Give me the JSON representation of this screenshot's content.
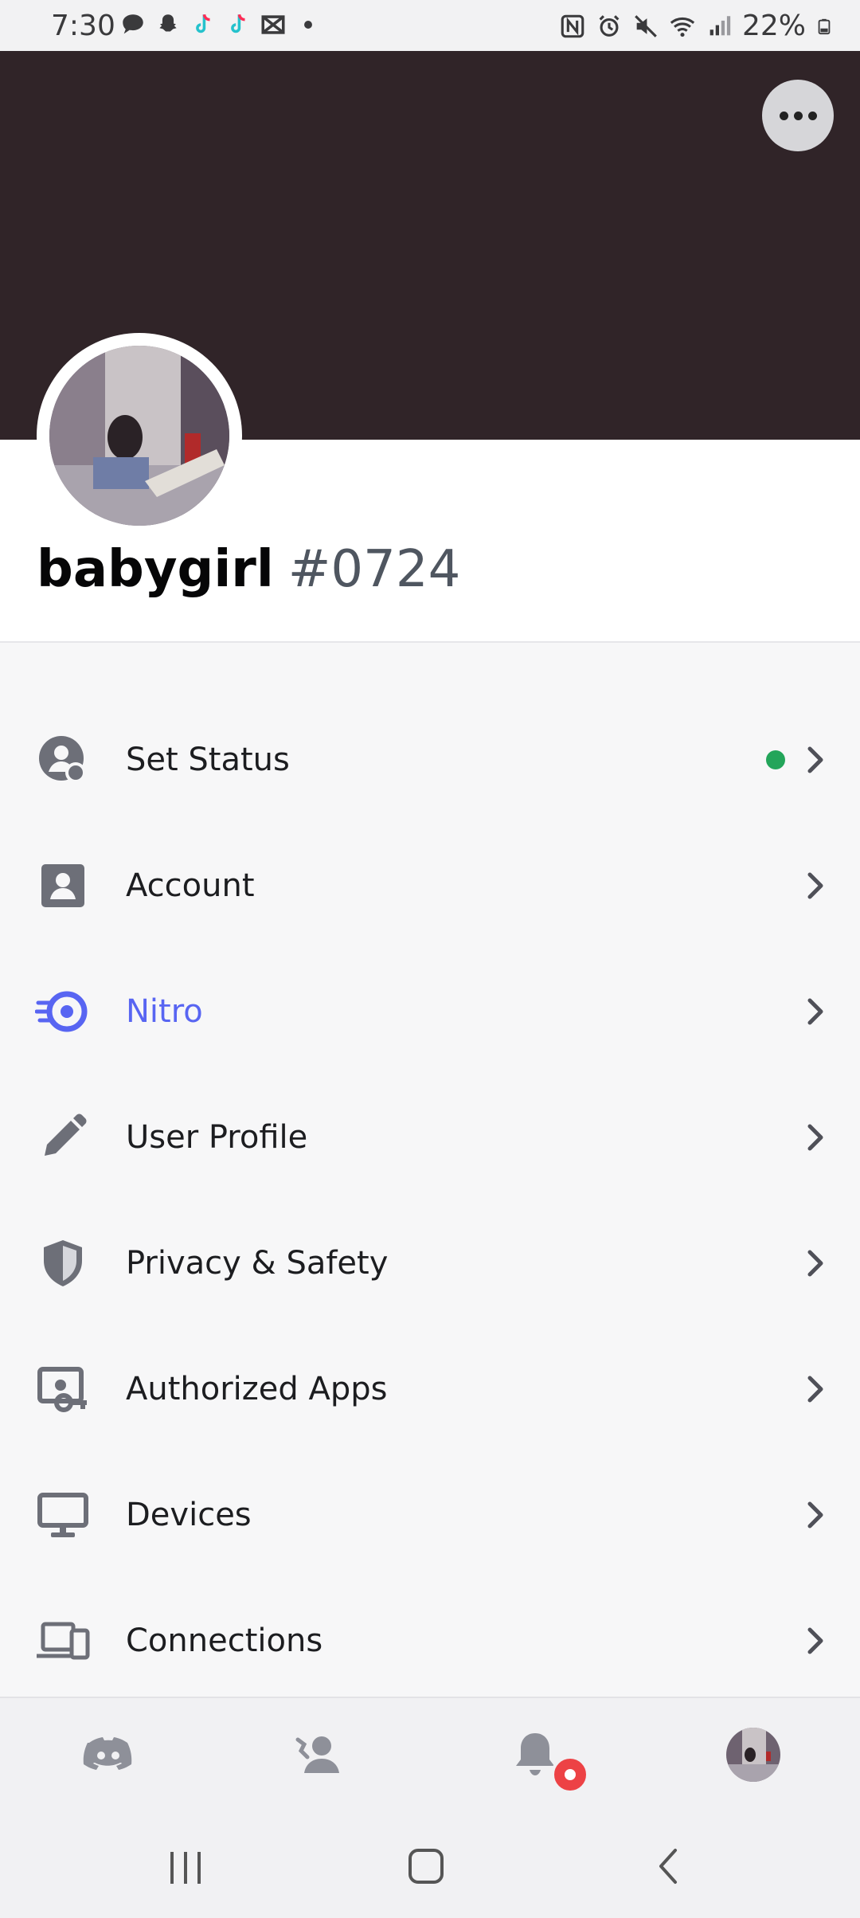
{
  "status_bar": {
    "time": "7:30",
    "battery": "22%",
    "icons": [
      "chat-bubble-icon",
      "snapchat-icon",
      "tiktok-icon",
      "tiktok-icon",
      "capcut-icon",
      "dot-icon",
      "nfc-icon",
      "alarm-icon",
      "mute-icon",
      "wifi-icon",
      "signal-icon",
      "battery-icon"
    ]
  },
  "profile": {
    "username": "babygirl",
    "discriminator": "#0724"
  },
  "menu": [
    {
      "label": "Set Status",
      "icon": "status-icon",
      "online": true
    },
    {
      "label": "Account",
      "icon": "account-icon"
    },
    {
      "label": "Nitro",
      "icon": "nitro-icon",
      "accent": "#5865f2"
    },
    {
      "label": "User Profile",
      "icon": "pencil-icon"
    },
    {
      "label": "Privacy & Safety",
      "icon": "shield-icon"
    },
    {
      "label": "Authorized Apps",
      "icon": "authorized-apps-icon"
    },
    {
      "label": "Devices",
      "icon": "monitor-icon"
    },
    {
      "label": "Connections",
      "icon": "connections-icon"
    }
  ],
  "bottom_nav": {
    "tabs": [
      "home",
      "friends",
      "notifications",
      "profile"
    ],
    "notification_badge": true
  },
  "colors": {
    "banner": "#302428",
    "online": "#23a55a",
    "nitro": "#5865f2",
    "badge": "#ed4245"
  }
}
